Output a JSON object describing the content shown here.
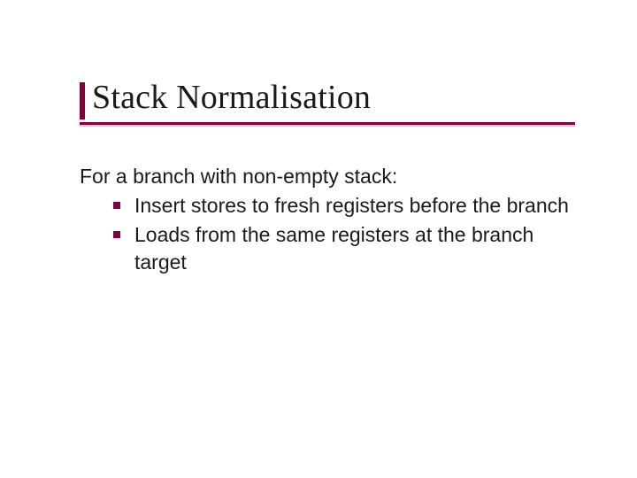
{
  "title": "Stack Normalisation",
  "lead": "For a branch with non-empty stack:",
  "bullets": [
    "Insert stores to fresh registers before the branch",
    "Loads from the same registers at the branch target"
  ],
  "accent_color": "#800040"
}
